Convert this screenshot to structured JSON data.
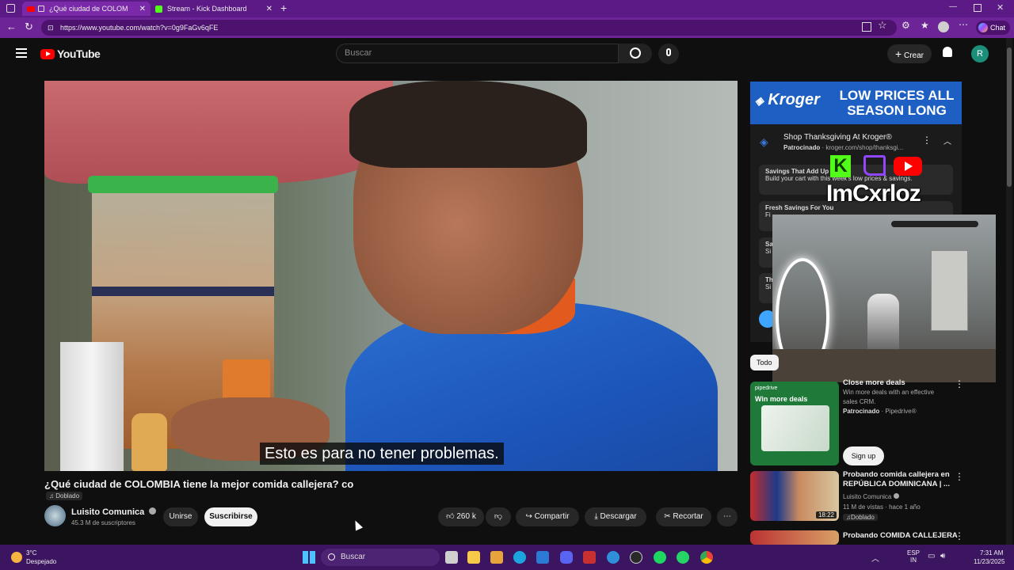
{
  "browser": {
    "tabs": [
      {
        "title": "¿Qué ciudad de COLOMBIA",
        "active": true
      },
      {
        "title": "Stream - Kick Dashboard",
        "active": false
      }
    ],
    "url": "https://www.youtube.com/watch?v=0g9FaGv6qFE",
    "chat_label": "Chat"
  },
  "youtube": {
    "logo_text": "YouTube",
    "search_placeholder": "Buscar",
    "create_label": "Crear",
    "avatar_letter": "R"
  },
  "video": {
    "subtitle": "Esto es para no tener problemas.",
    "title": "¿Qué ciudad de COLOMBIA tiene la mejor comida callejera? co",
    "dubbed_badge": "Doblado",
    "channel": "Luisito Comunica",
    "subscribers": "45.3 M de suscriptores",
    "join_label": "Unirse",
    "subscribe_label": "Suscribirse",
    "likes": "260 k",
    "share_label": "Compartir",
    "download_label": "Descargar",
    "clip_label": "Recortar"
  },
  "sponsor": {
    "banner_brand": "Kroger",
    "banner_text_1": "LOW PRICES ALL",
    "banner_text_2": "SEASON LONG",
    "ad_title": "Shop Thanksgiving At Kroger®",
    "ad_sponsored": "Patrocinado",
    "ad_url": "kroger.com/shop/thanksgi...",
    "items": [
      {
        "title": "Savings That Add Up",
        "desc": "Build your cart with this week's low prices & savings."
      },
      {
        "title": "Fresh Savings For You",
        "desc": "Fi"
      },
      {
        "title": "Sa",
        "desc": "Si"
      },
      {
        "title": "Th",
        "desc": "Si"
      }
    ]
  },
  "stream_overlay": {
    "name": "ImCxrloz"
  },
  "filter_chip": "Todo",
  "related": [
    {
      "title": "Close more deals",
      "desc": "Win more deals with an effective sales CRM.",
      "sponsored": "Patrocinado",
      "advertiser": "Pipedrive®",
      "thumb_brand": "pipedrive",
      "thumb_text": "Win more deals",
      "cta": "Sign up"
    },
    {
      "title": "Probando comida callejera en REPÚBLICA DOMINICANA | ...",
      "channel": "Luisito Comunica",
      "meta": "11 M de vistas · hace 1 año",
      "badge": "Doblado",
      "duration": "18:22"
    },
    {
      "title": "Probando COMIDA CALLEJERA"
    }
  ],
  "taskbar": {
    "weather_temp": "3°C",
    "weather_desc": "Despejado",
    "search_placeholder": "Buscar",
    "lang_1": "ESP",
    "lang_2": "IN",
    "time": "7:31 AM",
    "date": "11/23/2025"
  }
}
